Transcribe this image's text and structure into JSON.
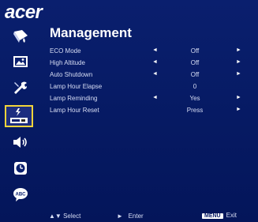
{
  "brand": "acer",
  "menu_title": "Management",
  "sidebar": {
    "items": [
      {
        "icon": "color-icon"
      },
      {
        "icon": "image-icon"
      },
      {
        "icon": "settings-icon"
      },
      {
        "icon": "management-icon",
        "active": true
      },
      {
        "icon": "audio-icon"
      },
      {
        "icon": "timer-icon"
      },
      {
        "icon": "language-icon"
      }
    ]
  },
  "rows": [
    {
      "label": "ECO Mode",
      "value": "Off",
      "left_arrow": "◄",
      "right_arrow": "►"
    },
    {
      "label": "High Altitude",
      "value": "Off",
      "left_arrow": "◄",
      "right_arrow": "►"
    },
    {
      "label": "Auto Shutdown",
      "value": "Off",
      "left_arrow": "◄",
      "right_arrow": "►"
    },
    {
      "label": "Lamp Hour Elapse",
      "value": "0",
      "left_arrow": "",
      "right_arrow": ""
    },
    {
      "label": "Lamp Reminding",
      "value": "Yes",
      "left_arrow": "◄",
      "right_arrow": "►"
    },
    {
      "label": "Lamp Hour Reset",
      "value": "Press",
      "left_arrow": "",
      "right_arrow": "►"
    }
  ],
  "footer": {
    "select_glyph": "▲▼",
    "select_label": "Select",
    "enter_glyph": "►",
    "enter_label": "Enter",
    "menu_key": "MENU",
    "exit_label": "Exit"
  },
  "colors": {
    "accent": "#f2d43a",
    "background": "#061a63",
    "text": "#d8def5"
  }
}
